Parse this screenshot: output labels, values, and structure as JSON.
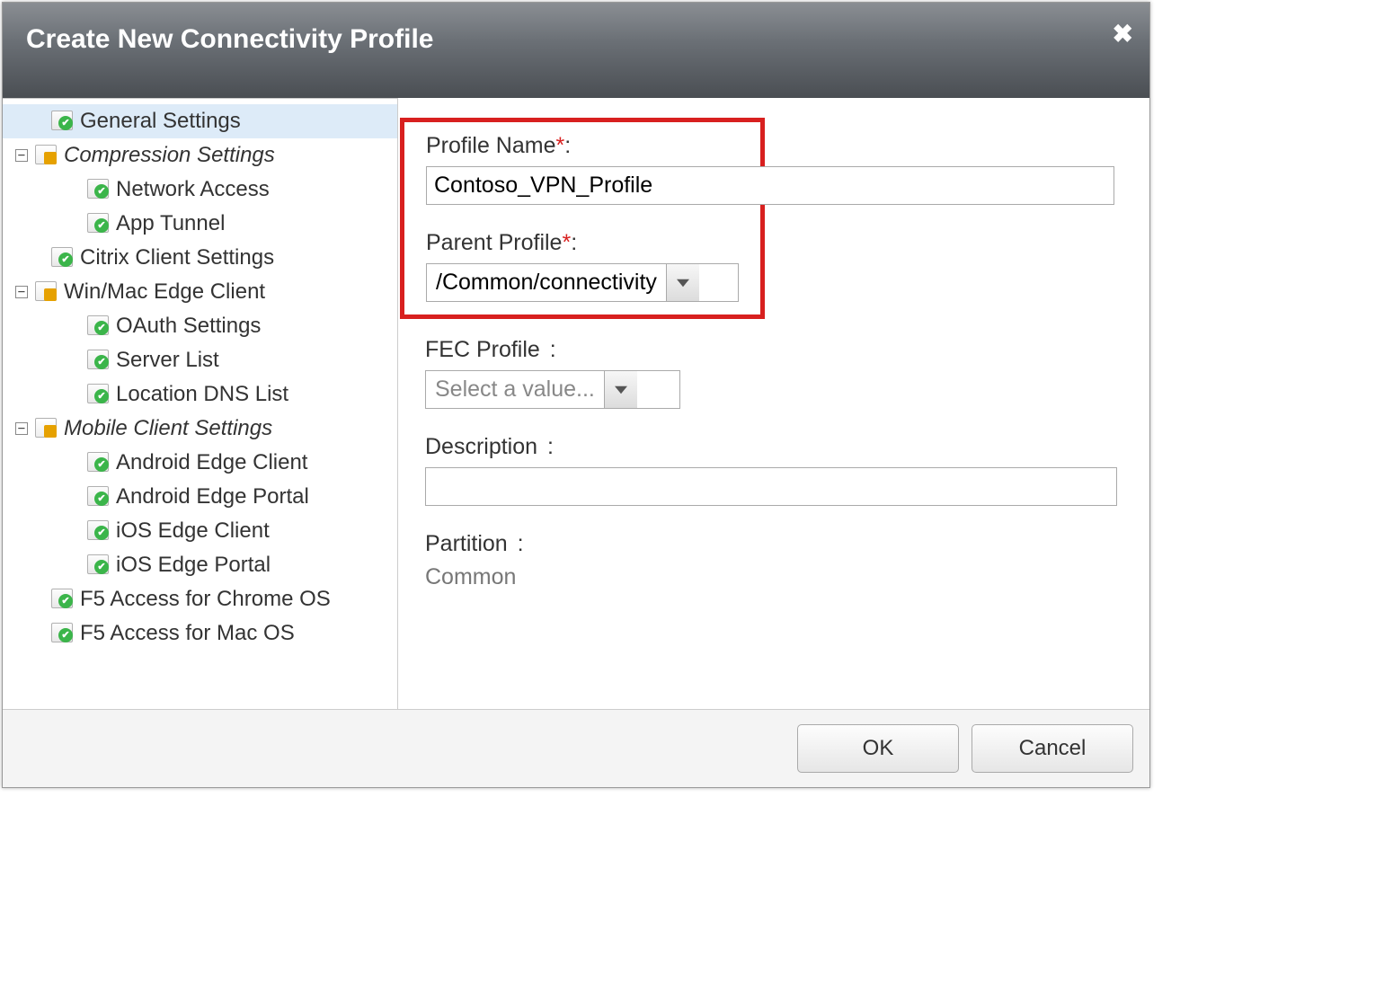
{
  "dialog": {
    "title": "Create New Connectivity Profile",
    "close_glyph": "✖"
  },
  "sidebar": {
    "items": [
      {
        "label": "General Settings",
        "level": 1,
        "icon": "page-check",
        "selected": true,
        "expander": null,
        "italic": false
      },
      {
        "label": "Compression Settings",
        "level": 0,
        "icon": "category",
        "selected": false,
        "expander": "−",
        "italic": true
      },
      {
        "label": "Network Access",
        "level": 2,
        "icon": "page-check",
        "selected": false,
        "expander": null,
        "italic": false
      },
      {
        "label": "App Tunnel",
        "level": 2,
        "icon": "page-check",
        "selected": false,
        "expander": null,
        "italic": false
      },
      {
        "label": "Citrix Client Settings",
        "level": 1,
        "icon": "page-check",
        "selected": false,
        "expander": null,
        "italic": false
      },
      {
        "label": "Win/Mac Edge Client",
        "level": 0,
        "icon": "category",
        "selected": false,
        "expander": "−",
        "italic": false
      },
      {
        "label": "OAuth Settings",
        "level": 2,
        "icon": "page-check",
        "selected": false,
        "expander": null,
        "italic": false
      },
      {
        "label": "Server List",
        "level": 2,
        "icon": "page-check",
        "selected": false,
        "expander": null,
        "italic": false
      },
      {
        "label": "Location DNS List",
        "level": 2,
        "icon": "page-check",
        "selected": false,
        "expander": null,
        "italic": false
      },
      {
        "label": "Mobile Client Settings",
        "level": 0,
        "icon": "category",
        "selected": false,
        "expander": "−",
        "italic": true
      },
      {
        "label": "Android Edge Client",
        "level": 2,
        "icon": "page-check",
        "selected": false,
        "expander": null,
        "italic": false
      },
      {
        "label": "Android Edge Portal",
        "level": 2,
        "icon": "page-check",
        "selected": false,
        "expander": null,
        "italic": false
      },
      {
        "label": "iOS Edge Client",
        "level": 2,
        "icon": "page-check",
        "selected": false,
        "expander": null,
        "italic": false
      },
      {
        "label": "iOS Edge Portal",
        "level": 2,
        "icon": "page-check",
        "selected": false,
        "expander": null,
        "italic": false
      },
      {
        "label": "F5 Access for Chrome OS",
        "level": 1,
        "icon": "page-check",
        "selected": false,
        "expander": null,
        "italic": false
      },
      {
        "label": "F5 Access for Mac OS",
        "level": 1,
        "icon": "page-check",
        "selected": false,
        "expander": null,
        "italic": false
      }
    ]
  },
  "form": {
    "profile_name": {
      "label": "Profile Name",
      "required": true,
      "value": "Contoso_VPN_Profile"
    },
    "parent_profile": {
      "label": "Parent Profile",
      "required": true,
      "value": "/Common/connectivity"
    },
    "fec_profile": {
      "label": "FEC Profile",
      "placeholder": "Select a value...",
      "value": ""
    },
    "description": {
      "label": "Description",
      "value": ""
    },
    "partition": {
      "label": "Partition",
      "value": "Common"
    }
  },
  "footer": {
    "ok_label": "OK",
    "cancel_label": "Cancel"
  }
}
